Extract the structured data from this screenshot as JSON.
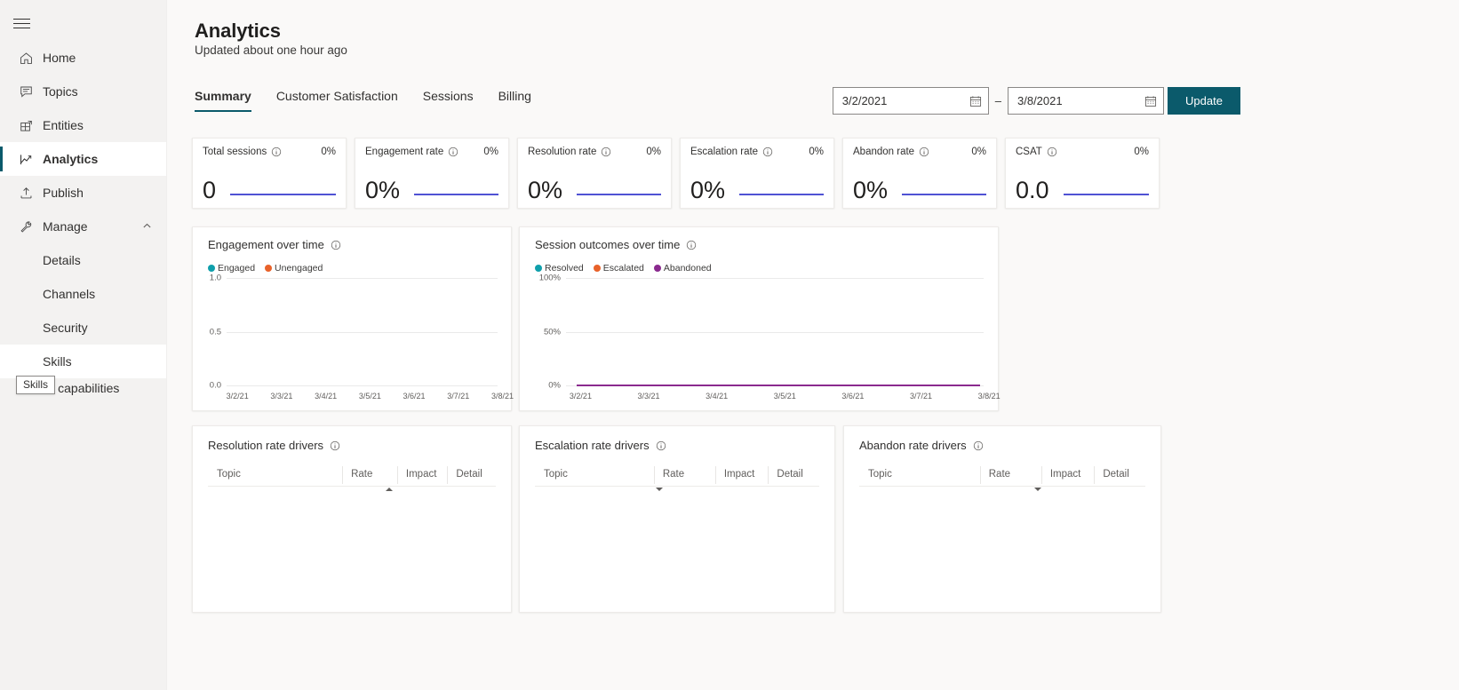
{
  "sidebar": {
    "menu_icon": "hamburger-icon",
    "items": [
      {
        "label": "Home",
        "icon": "home-icon",
        "level": "top",
        "selected": false
      },
      {
        "label": "Topics",
        "icon": "chat-icon",
        "level": "top",
        "selected": false
      },
      {
        "label": "Entities",
        "icon": "entities-icon",
        "level": "top",
        "selected": false
      },
      {
        "label": "Analytics",
        "icon": "analytics-chart-icon",
        "level": "top",
        "selected": true
      },
      {
        "label": "Publish",
        "icon": "publish-upload-icon",
        "level": "top",
        "selected": false
      },
      {
        "label": "Manage",
        "icon": "wrench-icon",
        "level": "top",
        "selected": false,
        "expanded": true,
        "chevron": "chevron-up-icon"
      },
      {
        "label": "Details",
        "icon": "",
        "level": "sub",
        "selected": false
      },
      {
        "label": "Channels",
        "icon": "",
        "level": "sub",
        "selected": false
      },
      {
        "label": "Security",
        "icon": "",
        "level": "sub",
        "selected": false
      },
      {
        "label": "Skills",
        "icon": "",
        "level": "sub",
        "selected": false,
        "hovered": true
      }
    ],
    "partially_hidden_item": "AI capabilities",
    "tooltip": "Skills"
  },
  "header": {
    "title": "Analytics",
    "subtitle": "Updated about one hour ago"
  },
  "tabs": [
    {
      "label": "Summary",
      "active": true
    },
    {
      "label": "Customer Satisfaction",
      "active": false
    },
    {
      "label": "Sessions",
      "active": false
    },
    {
      "label": "Billing",
      "active": false
    }
  ],
  "daterange": {
    "start_value": "3/2/2021",
    "end_value": "3/8/2021",
    "separator": "–",
    "calendar_icon": "calendar-icon",
    "update_label": "Update"
  },
  "kpis": [
    {
      "label": "Total sessions",
      "delta": "0%",
      "value": "0",
      "info_icon": "info-icon"
    },
    {
      "label": "Engagement rate",
      "delta": "0%",
      "value": "0%",
      "info_icon": "info-icon"
    },
    {
      "label": "Resolution rate",
      "delta": "0%",
      "value": "0%",
      "info_icon": "info-icon"
    },
    {
      "label": "Escalation rate",
      "delta": "0%",
      "value": "0%",
      "info_icon": "info-icon"
    },
    {
      "label": "Abandon rate",
      "delta": "0%",
      "value": "0%",
      "info_icon": "info-icon"
    },
    {
      "label": "CSAT",
      "delta": "0%",
      "value": "0.0",
      "info_icon": "info-icon"
    }
  ],
  "chart_data": [
    {
      "type": "line",
      "title": "Engagement over time",
      "info_icon": "info-icon",
      "legend": [
        {
          "name": "Engaged",
          "color": "#0f9fab"
        },
        {
          "name": "Unengaged",
          "color": "#e8622a"
        }
      ],
      "legend_position": "top-left",
      "x": [
        "3/2/21",
        "3/3/21",
        "3/4/21",
        "3/5/21",
        "3/6/21",
        "3/7/21",
        "3/8/21"
      ],
      "xlabel": "",
      "ylabel": "",
      "yticks": [
        "0.0",
        "0.5",
        "1.0"
      ],
      "ylim": [
        0,
        1
      ],
      "grid": true,
      "series": [
        {
          "name": "Engaged",
          "values": [
            0,
            0,
            0,
            0,
            0,
            0,
            0
          ]
        },
        {
          "name": "Unengaged",
          "values": [
            0,
            0,
            0,
            0,
            0,
            0,
            0
          ]
        }
      ]
    },
    {
      "type": "line",
      "title": "Session outcomes over time",
      "info_icon": "info-icon",
      "legend": [
        {
          "name": "Resolved",
          "color": "#0f9fab"
        },
        {
          "name": "Escalated",
          "color": "#e8622a"
        },
        {
          "name": "Abandoned",
          "color": "#8a2a8e"
        }
      ],
      "legend_position": "top-left",
      "x": [
        "3/2/21",
        "3/3/21",
        "3/4/21",
        "3/5/21",
        "3/6/21",
        "3/7/21",
        "3/8/21"
      ],
      "xlabel": "",
      "ylabel": "",
      "yticks": [
        "0%",
        "50%",
        "100%"
      ],
      "ylim": [
        0,
        100
      ],
      "grid": true,
      "series": [
        {
          "name": "Resolved",
          "values": [
            0,
            0,
            0,
            0,
            0,
            0,
            0
          ]
        },
        {
          "name": "Escalated",
          "values": [
            0,
            0,
            0,
            0,
            0,
            0,
            0
          ]
        },
        {
          "name": "Abandoned",
          "values": [
            0,
            0,
            0,
            0,
            0,
            0,
            0
          ]
        }
      ]
    }
  ],
  "driver_tables": [
    {
      "title": "Resolution rate drivers",
      "info_icon": "info-icon",
      "columns": [
        "Topic",
        "Rate",
        "Impact",
        "Detail"
      ],
      "sort_column": "Rate",
      "sort_direction": "asc",
      "rows": []
    },
    {
      "title": "Escalation rate drivers",
      "info_icon": "info-icon",
      "columns": [
        "Topic",
        "Rate",
        "Impact",
        "Detail"
      ],
      "sort_column": "Topic",
      "sort_direction": "desc",
      "rows": []
    },
    {
      "title": "Abandon rate drivers",
      "info_icon": "info-icon",
      "columns": [
        "Topic",
        "Rate",
        "Impact",
        "Detail"
      ],
      "sort_column": "Rate",
      "sort_direction": "desc",
      "rows": []
    }
  ],
  "colors": {
    "accent": "#0b5a6b",
    "sparkline": "#4f52d4",
    "teal": "#0f9fab",
    "orange": "#e8622a",
    "purple": "#8a2a8e",
    "sidebar_bg": "#f3f2f1",
    "page_bg": "#faf9f8"
  }
}
